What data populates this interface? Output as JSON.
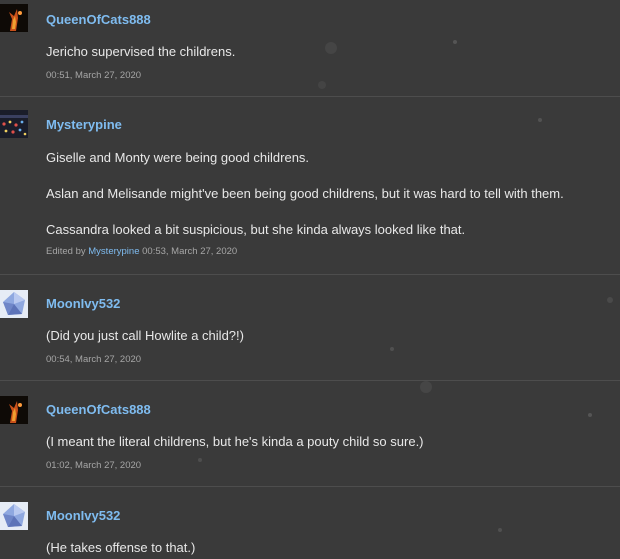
{
  "comments": [
    {
      "avatar": "cat-fire-avatar",
      "username": "QueenOfCats888",
      "paragraphs": [
        "Jericho supervised the childrens."
      ],
      "timestamp": "00:51, March 27, 2020"
    },
    {
      "avatar": "city-lights-avatar",
      "username": "Mysterypine",
      "paragraphs": [
        "Giselle and Monty were being good childrens.",
        "Aslan and Melisande might've been being good childrens, but it was hard to tell with them.",
        "Cassandra looked a bit suspicious, but she kinda always looked like that."
      ],
      "edited_prefix": "Edited by",
      "edited_by": "Mysterypine",
      "timestamp": "00:53, March 27, 2020"
    },
    {
      "avatar": "blue-crystal-avatar",
      "username": "MoonIvy532",
      "paragraphs": [
        "(Did you just call Howlite a child?!)"
      ],
      "timestamp": "00:54, March 27, 2020"
    },
    {
      "avatar": "cat-fire-avatar",
      "username": "QueenOfCats888",
      "paragraphs": [
        "(I meant the literal childrens, but he's kinda a pouty child so sure.)"
      ],
      "timestamp": "01:02, March 27, 2020"
    },
    {
      "avatar": "blue-crystal-avatar",
      "username": "MoonIvy532",
      "paragraphs": [
        "(He takes offense to that.)"
      ],
      "timestamp": ""
    }
  ],
  "colors": {
    "background": "#3a3a3a",
    "username": "#7fbcf0",
    "text": "#e8e8e8",
    "meta": "#a6a6a6",
    "divider": "#4d4d4d"
  }
}
